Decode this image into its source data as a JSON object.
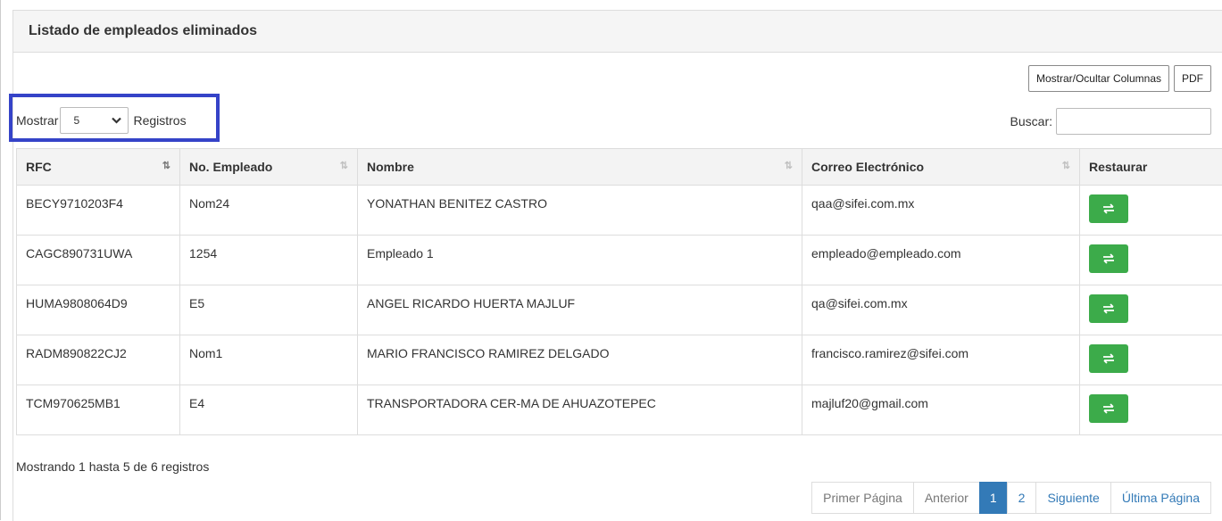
{
  "panel": {
    "title": "Listado de empleados eliminados"
  },
  "toolbar": {
    "toggle_columns_label": "Mostrar/Ocultar Columnas",
    "pdf_label": "PDF"
  },
  "length": {
    "prefix": "Mostrar",
    "selected": "5",
    "suffix": "Registros"
  },
  "search": {
    "label": "Buscar:",
    "value": ""
  },
  "table": {
    "columns": [
      "RFC",
      "No. Empleado",
      "Nombre",
      "Correo Electrónico",
      "Restaurar"
    ],
    "rows": [
      {
        "rfc": "BECY9710203F4",
        "num": "Nom24",
        "nombre": "YONATHAN BENITEZ CASTRO",
        "correo": "qaa@sifei.com.mx"
      },
      {
        "rfc": "CAGC890731UWA",
        "num": "1254",
        "nombre": "Empleado 1",
        "correo": "empleado@empleado.com"
      },
      {
        "rfc": "HUMA9808064D9",
        "num": "E5",
        "nombre": "ANGEL RICARDO HUERTA MAJLUF",
        "correo": "qa@sifei.com.mx"
      },
      {
        "rfc": "RADM890822CJ2",
        "num": "Nom1",
        "nombre": "MARIO FRANCISCO RAMIREZ DELGADO",
        "correo": "francisco.ramirez@sifei.com"
      },
      {
        "rfc": "TCM970625MB1",
        "num": "E4",
        "nombre": "TRANSPORTADORA CER-MA DE AHUAZOTEPEC",
        "correo": "majluf20@gmail.com"
      }
    ]
  },
  "info": "Mostrando 1 hasta 5 de 6 registros",
  "pagination": {
    "first": "Primer Página",
    "prev": "Anterior",
    "pages": [
      "1",
      "2"
    ],
    "next": "Siguiente",
    "last": "Última Página"
  },
  "colors": {
    "accent": "#337ab7",
    "restore": "#3cab4a",
    "highlight": "#3543c8"
  }
}
